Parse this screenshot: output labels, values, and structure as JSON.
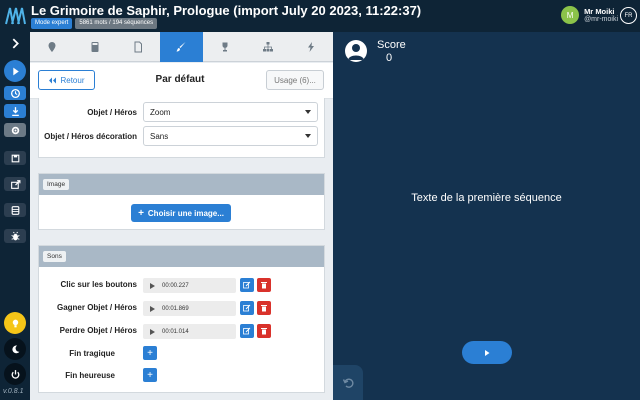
{
  "app": {
    "title": "Le Grimoire de Saphir, Prologue (import July 20 2023, 11:22:37)",
    "badge_mode": "Mode expert",
    "badge_stats": "5861 mots / 194 séquences"
  },
  "user": {
    "initial": "M",
    "name": "Mr Moiki",
    "handle": "@mr-moiki",
    "lang": "FR"
  },
  "sidebar": {
    "toggle_icon": "chevron-right-icon",
    "items": [
      "play-icon",
      "history-icon",
      "download-icon",
      "gear-icon",
      "save-icon",
      "export-icon",
      "database-icon",
      "bug-icon"
    ],
    "bottom_items": [
      "lightbulb-icon",
      "moon-icon",
      "power-icon"
    ],
    "version": "v.0.8.1"
  },
  "tabs": [
    "map-marker-icon",
    "calculator-icon",
    "file-icon",
    "paintbrush-icon",
    "trophy-icon",
    "sitemap-icon",
    "bolt-icon"
  ],
  "active_tab": 3,
  "header": {
    "back_label": "Retour",
    "title": "Par défaut",
    "usage_label": "Usage (6)..."
  },
  "objects": {
    "object_label": "Objet / Héros",
    "object_value": "Zoom",
    "decoration_label": "Objet / Héros décoration",
    "decoration_value": "Sans"
  },
  "image": {
    "title": "Image",
    "button_label": "Choisir une image..."
  },
  "sounds": {
    "title": "Sons",
    "rows": [
      {
        "label": "Clic sur les boutons",
        "time": "00:00.227"
      },
      {
        "label": "Gagner Objet / Héros",
        "time": "00:01.869"
      },
      {
        "label": "Perdre Objet / Héros",
        "time": "00:01.014"
      }
    ],
    "empty_rows": [
      "Fin tragique",
      "Fin heureuse"
    ]
  },
  "preview": {
    "score_label": "Score",
    "score_value": "0",
    "sequence_text": "Texte de la première séquence"
  },
  "colors": {
    "accent": "#2b7fd4",
    "danger": "#d9322b",
    "dark_bg": "#0e2436",
    "preview_bg": "#14324f"
  }
}
